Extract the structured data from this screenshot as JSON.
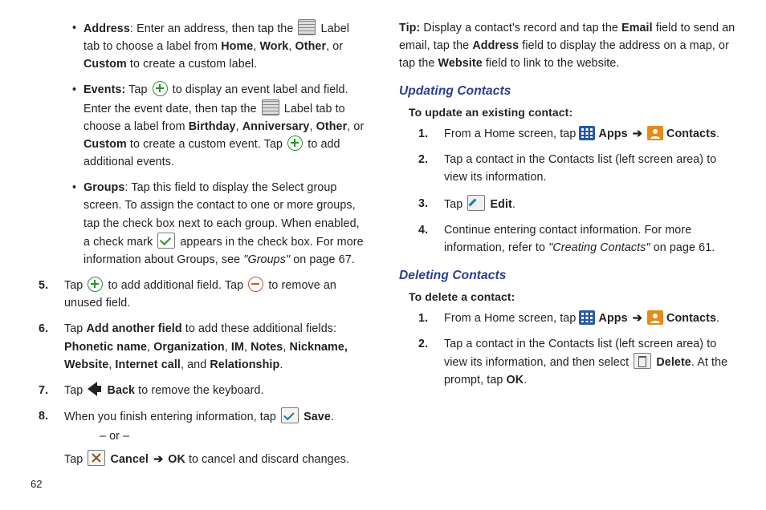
{
  "left": {
    "bullets": {
      "address": {
        "label": "Address",
        "t1": ": Enter an address, then tap the ",
        "t2": " Label tab to choose a label from ",
        "opt1": "Home",
        "c1": ", ",
        "opt2": "Work",
        "c2": ", ",
        "opt3": "Other",
        "c3": ", or ",
        "opt4": "Custom",
        "t3": " to create a custom label."
      },
      "events": {
        "label": "Events:",
        "t1": " Tap ",
        "t2": " to display an event label and field. Enter the event date, then tap the ",
        "t3": " Label tab to choose a label from ",
        "opt1": "Birthday",
        "c1": ", ",
        "opt2": "Anniversary",
        "c2": ", ",
        "opt3": "Other",
        "c3": ", or ",
        "opt4": "Custom",
        "t4": " to create a custom event. Tap ",
        "t5": " to add additional events."
      },
      "groups": {
        "label": "Groups",
        "t1": ": Tap this field to display the Select group screen. To assign the contact to one or more groups, tap the check box next to each group. When enabled, a check mark ",
        "t2": " appears in the check box. For more information about Groups, see ",
        "ref": "\"Groups\"",
        "t3": " on page 67."
      }
    },
    "steps": {
      "s5a": "Tap ",
      "s5b": " to add additional field. Tap ",
      "s5c": " to remove an unused field.",
      "s6a": "Tap ",
      "s6b": "Add another field",
      "s6c": " to add these additional fields: ",
      "s6list": {
        "f1": "Phonetic name",
        "c1": ", ",
        "f2": "Organization",
        "c2": ", ",
        "f3": "IM",
        "c3": ", ",
        "f4": "Notes",
        "c4": ", ",
        "f5": "Nickname,",
        "f6": "Website",
        "c5": ", ",
        "f7": "Internet call",
        "c6": ", and ",
        "f8": "Relationship",
        "c7": "."
      },
      "s7a": "Tap ",
      "s7b": "Back",
      "s7c": " to remove the keyboard.",
      "s8a": "When you finish entering information, tap ",
      "s8b": "Save",
      "s8c": ".",
      "or": "– or –",
      "s8d": "Tap ",
      "s8e": "Cancel",
      "s8f": "OK",
      "s8g": " to cancel and discard changes."
    }
  },
  "right": {
    "tip": {
      "label": "Tip:",
      "t1": " Display a contact's record and tap the ",
      "email": "Email",
      "t2": " field to send an email, tap the ",
      "address": "Address",
      "t3": " field to display the address on a map, or tap the ",
      "website": "Website",
      "t4": " field to link to the website."
    },
    "updating": {
      "heading": "Updating Contacts",
      "lead": "To update an existing contact:",
      "s1a": "From a Home screen, tap ",
      "apps": "Apps",
      "contacts": "Contacts",
      "dot": ".",
      "s2": "Tap a contact in the Contacts list (left screen area) to view its information.",
      "s3a": "Tap ",
      "edit": "Edit",
      "s4a": "Continue entering contact information. For more information, refer to ",
      "ref": "\"Creating Contacts\"",
      "s4b": "  on page 61."
    },
    "deleting": {
      "heading": "Deleting Contacts",
      "lead": "To delete a contact:",
      "s1a": "From a Home screen, tap ",
      "apps": "Apps",
      "contacts": "Contacts",
      "dot": ".",
      "s2a": "Tap a contact in the Contacts list (left screen area) to view its information, and then select ",
      "delete": "Delete",
      "s2b": ". At the prompt, tap ",
      "ok": "OK",
      "s2c": "."
    }
  },
  "pagenum": "62",
  "arrow": "➔"
}
